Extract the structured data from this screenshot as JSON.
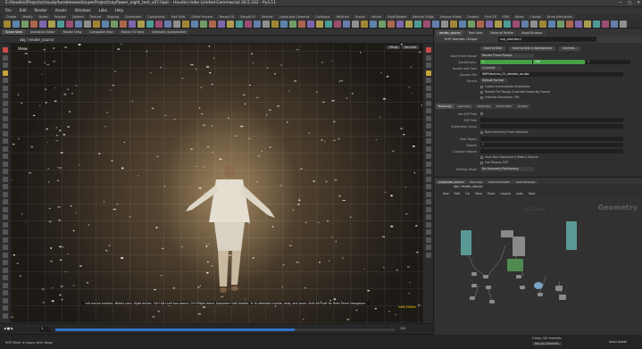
{
  "window": {
    "title": "E:/Houdini/Projects/cloudy/tumbleweed/superProject/sayflower_eight_test_v07.hiplc - Houdini Indie Limited-Commercial 20.5.332 - Py3.11",
    "controls": [
      "−",
      "□",
      "✕"
    ]
  },
  "menu": [
    "File",
    "Edit",
    "Render",
    "Assets",
    "Windows",
    "Labs",
    "Help"
  ],
  "shelf_tabs": [
    "Create",
    "Modify",
    "Model",
    "Polygon",
    "Deform",
    "Texture",
    "Rigging",
    "Characters",
    "Constraints",
    "Hair Utils",
    "Guide Process",
    "Terrain FX",
    "Simple FX",
    "Volume",
    "Lights and Cameras",
    "Collisions",
    "Particles",
    "Grains",
    "Vellum",
    "Rigid Bodies",
    "Particle Fluids",
    "Viscous Fluids",
    "Oceans",
    "Pyro FX",
    "FEM",
    "Wires",
    "Crowds",
    "Drive Simulation"
  ],
  "left_pane_tabs": [
    {
      "label": "Scene View",
      "active": true
    },
    {
      "label": "Animation Editor",
      "active": false
    },
    {
      "label": "Render View",
      "active": false
    },
    {
      "label": "Composite View",
      "active": false
    },
    {
      "label": "Motion FX View",
      "active": false
    },
    {
      "label": "Geometry Spreadsheet",
      "active": false
    }
  ],
  "viewport": {
    "path": "obj / render_source",
    "label": "View",
    "camera_menu": "Persp",
    "display_menu": "No cam",
    "hint": "Left mouse tumbles. Middle pans. Right dollies. Ctrl+Alt+Left box-zooms. Ctrl+Right menu. Spacebar+Left tumble. 'b' to alternate tumble, dolly, and zoom.  Shift-Alt+Left for Point Picker Navigation.",
    "badge": "Indie Edition"
  },
  "timeline": {
    "frame": "1",
    "start": "1",
    "end": "240",
    "progress": 0.705,
    "play_controls": [
      "⏮",
      "◀",
      "■",
      "▶",
      "⏭"
    ],
    "keys_label": "0 keys, 0/0 channels",
    "key_all": "Key All Channels"
  },
  "status": {
    "text": "ROP Mesh is happy with stage",
    "right": "Auto Update"
  },
  "parameters": {
    "tabs": [
      {
        "label": "render_source",
        "active": true
      },
      {
        "label": "Tree View",
        "active": false
      },
      {
        "label": "Material Palette",
        "active": false
      },
      {
        "label": "Asset Browser",
        "active": false
      }
    ],
    "node_type": "ROP Alembic Output",
    "node_name": "rop_alembic1",
    "buttons": [
      "Save to Disk",
      "Save to Disk in Background",
      "Controls..."
    ],
    "rows": [
      {
        "key": "Valid Frame Range",
        "value": "Render Frame Range"
      },
      {
        "key": "Start/End/Inc",
        "value": "1",
        "value2": "240",
        "value3": "1"
      },
      {
        "key": "Render with Take",
        "value": "(Current)"
      },
      {
        "key": "Alembic File",
        "value": "$HIP/abc/sim_01_alembic_ex.abc"
      },
      {
        "key": "Format",
        "value": "Default Format"
      }
    ],
    "checkboxes": [
      "Create Intermediate Directories",
      "Render Full Range (Override Frame-By-Frame)",
      "Initialize Simulation OPs"
    ],
    "sub_tabs": [
      {
        "label": "Hierarchy",
        "active": true
      },
      {
        "label": "Geometry",
        "active": false
      },
      {
        "label": "Attributes",
        "active": false
      },
      {
        "label": "Motion Blur",
        "active": false
      },
      {
        "label": "Scripts",
        "active": false
      }
    ],
    "lower_rows": [
      {
        "key": "Use SOP Path",
        "value": ""
      },
      {
        "key": "SOP Path",
        "value": ""
      },
      {
        "key": "Subdivision Group",
        "value": ""
      },
      {
        "key": "",
        "value": "Build Hierarchy From Attribute"
      },
      {
        "key": "Root Object",
        "value": ""
      },
      {
        "key": "Objects",
        "value": "*"
      },
      {
        "key": "Collapse Objects",
        "value": ""
      }
    ],
    "lower_checks": [
      "Save Non-Displayed (Hidden) Objects",
      "Use Display SOP"
    ],
    "partition": {
      "key": "Partition Mode",
      "value": "No Geometry Partitioning"
    }
  },
  "network": {
    "tabs": [
      {
        "label": "/obj/render_source",
        "active": true
      },
      {
        "label": "Tree View",
        "active": false
      },
      {
        "label": "Material Palette",
        "active": false
      },
      {
        "label": "Asset Browser",
        "active": false
      }
    ],
    "path": "obj / render_source",
    "menu": [
      "Add",
      "Edit",
      "Go",
      "View",
      "Tools",
      "Layout",
      "Labs",
      "Help"
    ],
    "context": "Geometry",
    "node_label": "IndiE Edition"
  },
  "colors": {
    "accent_blue": "#2f73c8",
    "node_teal": "#5a9a96",
    "node_green": "#4f8a4f",
    "node_blue": "#7aa2c4",
    "node_gray": "#8a8a8a",
    "frame_green": "#46a046"
  }
}
